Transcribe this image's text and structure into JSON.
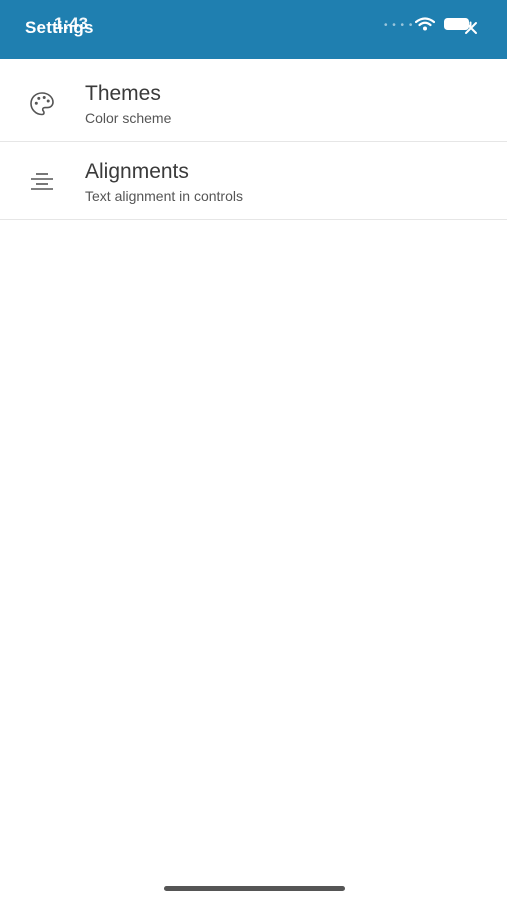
{
  "status_bar": {
    "time": "1:43",
    "signal_dots": "• • • •"
  },
  "app_bar": {
    "title": "Settings"
  },
  "settings": {
    "items": [
      {
        "icon": "palette-icon",
        "title": "Themes",
        "subtitle": "Color scheme"
      },
      {
        "icon": "align-center-icon",
        "title": "Alignments",
        "subtitle": "Text alignment in controls"
      }
    ]
  },
  "colors": {
    "app_bar_background": "#1f7fb0",
    "text_primary": "#3a3a3a",
    "text_secondary": "#555555"
  }
}
